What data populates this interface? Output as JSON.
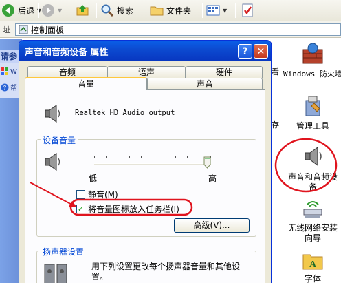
{
  "toolbar": {
    "back_label": "后退",
    "search_label": "搜索",
    "folders_label": "文件夹"
  },
  "address": {
    "label": "址",
    "path": "控制面板"
  },
  "left_panel": {
    "header": "请参",
    "items": [
      "W",
      "帮"
    ]
  },
  "right_icons": [
    {
      "label": "Windows 防火墙",
      "icon": "firewall-icon"
    },
    {
      "label": "管理工具",
      "icon": "admin-tools-icon"
    },
    {
      "label": "声音和音频设备",
      "icon": "speaker-icon"
    },
    {
      "label": "无线网络安装向导",
      "icon": "wireless-icon"
    },
    {
      "label": "字体",
      "icon": "fonts-folder-icon"
    }
  ],
  "right_edge_texts": [
    "看",
    "存"
  ],
  "dialog": {
    "title": "声音和音频设备 属性",
    "help_glyph": "?",
    "close_glyph": "✕",
    "tabs_row1": [
      "音频",
      "语声",
      "硬件"
    ],
    "tabs_row2": [
      "音量",
      "声音"
    ],
    "active_tab": "音量",
    "device_name": "Realtek HD Audio output",
    "volume_group": {
      "title": "设备音量",
      "low_label": "低",
      "high_label": "高",
      "level": 1.0
    },
    "mute_label": "静音(M)",
    "mute_checked": false,
    "tray_label": "将音量图标放入任务栏(I)",
    "tray_checked": true,
    "advanced_label": "高级(V)...",
    "speaker_group": {
      "title": "扬声器设置",
      "desc_line1": "用下列设置更改每个扬声器音量和其他设",
      "desc_line2": "置。"
    }
  },
  "colors": {
    "titlebar": "#0a5fe8",
    "annotation_red": "#e0141e",
    "group_title": "#0046d5"
  }
}
